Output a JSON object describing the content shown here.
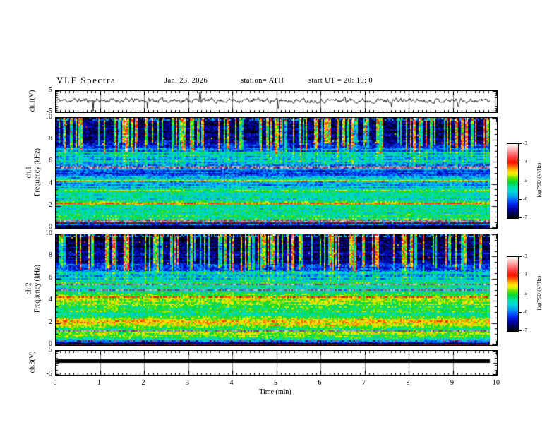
{
  "header": {
    "title": "VLF  Spectra",
    "date": "Jan. 23, 2026",
    "station": "station= ATH",
    "start_ut": "start UT =  20: 10: 0"
  },
  "xaxis": {
    "label": "Time  (min)",
    "tick_labels": [
      "0",
      "1",
      "2",
      "3",
      "4",
      "5",
      "6",
      "7",
      "8",
      "9",
      "10"
    ]
  },
  "panels": {
    "ch1_wave": {
      "ylabel": "ch.1(V)",
      "ytick_labels": [
        "5",
        "-5"
      ]
    },
    "ch1_spec": {
      "ylabel_channel": "ch.1",
      "ylabel_axis": "Frequency  (kHz)",
      "ytick_labels": [
        "10",
        "8",
        "6",
        "4",
        "2",
        "0"
      ]
    },
    "ch2_spec": {
      "ylabel_channel": "ch.2",
      "ylabel_axis": "Frequency  (kHz)",
      "ytick_labels": [
        "10",
        "8",
        "6",
        "4",
        "2",
        "0"
      ]
    },
    "ch3_wave": {
      "ylabel": "ch.3(V)",
      "ytick_labels": [
        "5",
        "-5"
      ]
    }
  },
  "colorbar": {
    "label": "log(PSD)(V²/Hz)",
    "tick_labels": [
      "-3",
      "-4",
      "-5",
      "-6",
      "-7"
    ]
  },
  "chart_data": {
    "type": "heatmap",
    "figure": "VLF spectra summary plot: ch.1 voltage waveform, ch.1 and ch.2 spectrograms (0-10 kHz), ch.3 flat voltage trace, shared 0-10 min time axis",
    "station": "ATH",
    "date": "Jan. 23, 2026",
    "start_ut": "20:10:0",
    "time_axis": {
      "min": 0,
      "max": 10,
      "major_tick": 1,
      "minor_tick": 0.1,
      "data_end_min": 9.84,
      "label": "Time (min)"
    },
    "colormap_stops": [
      [
        0.0,
        "#000000"
      ],
      [
        0.06,
        "#000050"
      ],
      [
        0.12,
        "#0000a0"
      ],
      [
        0.18,
        "#0020e0"
      ],
      [
        0.24,
        "#0060ff"
      ],
      [
        0.3,
        "#00a8f0"
      ],
      [
        0.36,
        "#00d8d8"
      ],
      [
        0.42,
        "#00e0a0"
      ],
      [
        0.48,
        "#00d840"
      ],
      [
        0.54,
        "#60e000"
      ],
      [
        0.58,
        "#d8f000"
      ],
      [
        0.62,
        "#ffe800"
      ],
      [
        0.66,
        "#ffa800"
      ],
      [
        0.7,
        "#ff6000"
      ],
      [
        0.75,
        "#ff1000"
      ],
      [
        0.82,
        "#ff4040"
      ],
      [
        0.9,
        "#ff9898"
      ],
      [
        0.96,
        "#ffd8d8"
      ],
      [
        1.0,
        "#ffffff"
      ]
    ],
    "colorbar": {
      "range_log_psd": [
        -7,
        -3
      ],
      "ticks": [
        -3,
        -4,
        -5,
        -6,
        -7
      ],
      "label": "log(PSD)(V2/Hz)",
      "orientation": "vertical",
      "position": "right"
    },
    "panels": [
      {
        "id": "ch1_wave",
        "kind": "line",
        "ylabel": "ch.1(V)",
        "ylim": [
          -5,
          5
        ],
        "yticks": [
          5,
          -5
        ],
        "baseline_v": 0.6,
        "noise_amp_v": 1.1,
        "spikes_t_v": [
          [
            0.85,
            -4.5
          ],
          [
            2.08,
            -3.2
          ],
          [
            3.27,
            4.5
          ],
          [
            5.05,
            -3.0
          ],
          [
            6.55,
            2.2
          ],
          [
            7.62,
            -2.7
          ],
          [
            9.13,
            -2.3
          ]
        ],
        "seed": 11
      },
      {
        "id": "ch1_spec",
        "kind": "spectrogram",
        "ylabel": "ch.1 Frequency (kHz)",
        "ylim": [
          0,
          10
        ],
        "yticks": [
          10,
          8,
          6,
          4,
          2,
          0
        ],
        "value_scale": "log PSD from -7 (0.0) to -3 (1.0)",
        "profile_f_v": [
          [
            10,
            0.05
          ],
          [
            9.2,
            0.07
          ],
          [
            8.0,
            0.12
          ],
          [
            7.4,
            0.16
          ],
          [
            7.1,
            0.26
          ],
          [
            6.4,
            0.3
          ],
          [
            5.8,
            0.27
          ],
          [
            5.3,
            0.24
          ],
          [
            4.8,
            0.22
          ],
          [
            4.35,
            0.42
          ],
          [
            4.1,
            0.3
          ],
          [
            3.7,
            0.33
          ],
          [
            3.35,
            0.44
          ],
          [
            3.0,
            0.38
          ],
          [
            2.6,
            0.4
          ],
          [
            2.3,
            0.58
          ],
          [
            2.0,
            0.46
          ],
          [
            1.6,
            0.4
          ],
          [
            1.2,
            0.46
          ],
          [
            0.95,
            0.42
          ],
          [
            0.8,
            0.38
          ],
          [
            0.55,
            0.3
          ],
          [
            0.3,
            0.22
          ],
          [
            0.18,
            0.03
          ],
          [
            0,
            0.02
          ]
        ],
        "stripes": [
          {
            "f": 6.85,
            "type": "boost",
            "amt": 0.12
          },
          {
            "f": 6.55,
            "type": "boost",
            "amt": 0.13
          },
          {
            "f": 6.05,
            "type": "boost",
            "amt": 0.14
          },
          {
            "f": 5.62,
            "type": "graymag"
          },
          {
            "f": 5.45,
            "type": "graymag"
          },
          {
            "f": 4.3,
            "type": "boost",
            "amt": 0.18
          },
          {
            "f": 3.35,
            "type": "boost",
            "amt": 0.1
          },
          {
            "f": 2.3,
            "type": "boost",
            "amt": 0.1
          },
          {
            "f": 0.88,
            "type": "boost",
            "amt": 0.12
          },
          {
            "f": 0.75,
            "type": "graymag"
          },
          {
            "f": 0.62,
            "type": "graymag"
          },
          {
            "f": 0.45,
            "type": "darkred"
          }
        ],
        "streaks": {
          "count": 130,
          "fbase_min": 6.8,
          "fbase_span": 1.0,
          "boost_min": 0.22,
          "boost_span": 0.42,
          "fade_to": 5.7
        },
        "seed": 42
      },
      {
        "id": "ch2_spec",
        "kind": "spectrogram",
        "ylabel": "ch.2 Frequency (kHz)",
        "ylim": [
          0,
          10
        ],
        "yticks": [
          10,
          8,
          6,
          4,
          2,
          0
        ],
        "value_scale": "log PSD from -7 (0.0) to -3 (1.0)",
        "profile_f_v": [
          [
            10,
            0.04
          ],
          [
            9.0,
            0.06
          ],
          [
            8.0,
            0.1
          ],
          [
            7.4,
            0.14
          ],
          [
            7.0,
            0.22
          ],
          [
            6.6,
            0.27
          ],
          [
            6.1,
            0.31
          ],
          [
            5.7,
            0.42
          ],
          [
            5.45,
            0.46
          ],
          [
            5.1,
            0.35
          ],
          [
            4.8,
            0.45
          ],
          [
            4.55,
            0.5
          ],
          [
            4.3,
            0.62
          ],
          [
            4.05,
            0.57
          ],
          [
            3.7,
            0.53
          ],
          [
            3.3,
            0.47
          ],
          [
            2.9,
            0.45
          ],
          [
            2.55,
            0.48
          ],
          [
            2.25,
            0.62
          ],
          [
            2.05,
            0.66
          ],
          [
            1.8,
            0.54
          ],
          [
            1.5,
            0.48
          ],
          [
            1.15,
            0.52
          ],
          [
            0.85,
            0.5
          ],
          [
            0.6,
            0.4
          ],
          [
            0.4,
            0.28
          ],
          [
            0.22,
            0.05
          ],
          [
            0.1,
            0.04
          ],
          [
            0,
            0.06
          ]
        ],
        "stripes": [
          {
            "f": 6.55,
            "type": "boost",
            "amt": 0.1
          },
          {
            "f": 6.15,
            "type": "boost",
            "amt": 0.12
          },
          {
            "f": 5.5,
            "type": "graymag"
          },
          {
            "f": 5.05,
            "type": "graymag"
          },
          {
            "f": 4.32,
            "type": "reddash"
          },
          {
            "f": 2.12,
            "type": "orangedash"
          },
          {
            "f": 1.38,
            "type": "graymag"
          },
          {
            "f": 0.5,
            "type": "magdot"
          },
          {
            "f": 0.07,
            "type": "darkred"
          }
        ],
        "streaks": {
          "count": 120,
          "fbase_min": 6.6,
          "fbase_span": 1.0,
          "boost_min": 0.22,
          "boost_span": 0.4,
          "fade_to": 5.8
        },
        "seed": 77
      },
      {
        "id": "ch3_wave",
        "kind": "flatline",
        "ylabel": "ch.3(V)",
        "ylim": [
          -5,
          5
        ],
        "yticks": [
          5,
          -5
        ],
        "value_v": 0.6,
        "line_thickness_px": 5,
        "seed": 5
      }
    ]
  },
  "colors": {
    "axis": "#000000",
    "grid_minor_line": "#777777",
    "trace": "#000000",
    "background": "#ffffff"
  }
}
